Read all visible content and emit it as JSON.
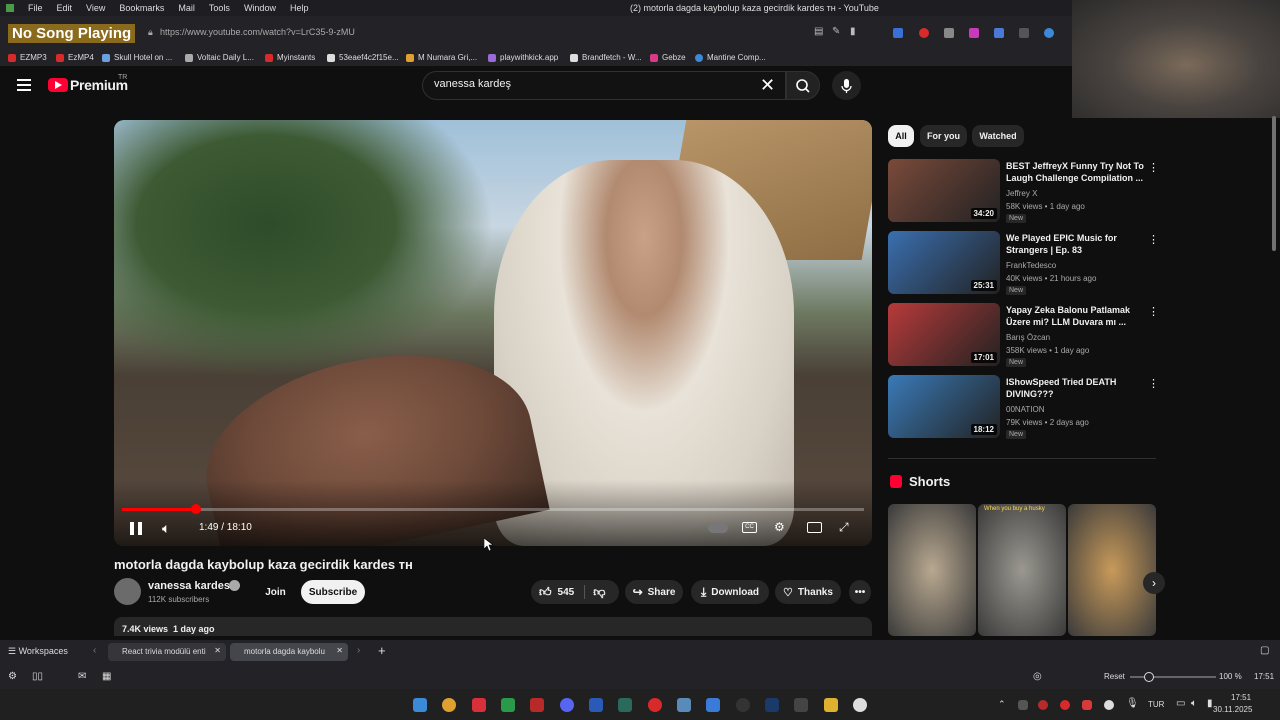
{
  "os_menu": {
    "items": [
      "File",
      "Edit",
      "View",
      "Bookmarks",
      "Mail",
      "Tools",
      "Window",
      "Help"
    ],
    "window_title": "(2) motorla dagda kaybolup kaza gecirdik kardes ᴛʜ - YouTube"
  },
  "browser": {
    "now_playing": "No Song Playing",
    "url": "https://www.youtube.com/watch?v=LrC35-9-zMU",
    "bookmarks": [
      "EZMP3",
      "EzMP4",
      "Skull Hotel on ...",
      "Voltaic Daily L...",
      "Myinstants",
      "53eaef4c2f15e...",
      "M Numara Gri,...",
      "playwithkick.app",
      "Brandfetch - W...",
      "Gebze",
      "Mantine Comp..."
    ],
    "workspaces_label": "Workspaces",
    "tabs": [
      "React trivia modülü enti",
      "motorla dagda kaybolu"
    ],
    "zoom_reset": "Reset",
    "zoom_level": "100 %",
    "clock": "17:51"
  },
  "youtube": {
    "logo_text": "Premium",
    "logo_sup": "TR",
    "search_value": "vanessa kardeş",
    "player": {
      "time": "1:49 / 18:10",
      "progress_fraction": 0.1
    },
    "video": {
      "title": "motorla dagda kaybolup kaza gecirdik kardes ᴛʜ",
      "channel": "vanessa kardes",
      "subscribers": "112K subscribers",
      "join": "Join",
      "subscribe": "Subscribe",
      "likes": "545",
      "share": "Share",
      "download": "Download",
      "thanks": "Thanks",
      "views_date": "7.4K views  1 day ago"
    },
    "chips": [
      "All",
      "For you",
      "Watched"
    ],
    "recommendations": [
      {
        "title": "BEST JeffreyX Funny Try Not To Laugh Challenge Compilation ...",
        "channel": "Jeffrey X",
        "meta": "58K views • 1 day ago",
        "badge": "New",
        "duration": "34:20",
        "color": "#7a4a3a"
      },
      {
        "title": "We Played EPIC Music for Strangers | Ep. 83",
        "channel": "FrankTedesco",
        "meta": "40K views • 21 hours ago",
        "badge": "New",
        "duration": "25:31",
        "color": "#3a6fb0"
      },
      {
        "title": "Yapay Zeka Balonu Patlamak Üzere mi? LLM Duvara mı ...",
        "channel": "Barış Özcan",
        "meta": "358K views • 1 day ago",
        "badge": "New",
        "duration": "17:01",
        "color": "#b83a3a"
      },
      {
        "title": "IShowSpeed Tried DEATH DIVING???",
        "channel": "00NATION",
        "meta": "79K views • 2 days ago",
        "badge": "New",
        "duration": "18:12",
        "color": "#3a7ab8"
      }
    ],
    "shorts_title": "Shorts",
    "shorts": [
      {
        "caption": "",
        "color": "#b8a890"
      },
      {
        "caption": "When you buy a husky",
        "color": "#9a9890"
      },
      {
        "caption": "",
        "color": "#c89a5a"
      }
    ]
  },
  "taskbar": {
    "lang": "TUR",
    "time": "17:51",
    "date": "30.11.2025"
  }
}
